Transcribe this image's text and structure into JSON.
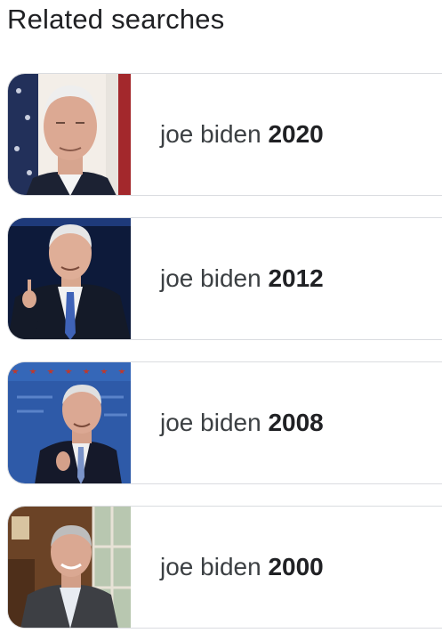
{
  "section": {
    "title": "Related searches"
  },
  "related_searches": [
    {
      "query_prefix": "joe biden",
      "query_bold": "2020",
      "thumbnail": "biden-2020-portrait-photo"
    },
    {
      "query_prefix": "joe biden",
      "query_bold": "2012",
      "thumbnail": "biden-2012-debate-photo"
    },
    {
      "query_prefix": "joe biden",
      "query_bold": "2008",
      "thumbnail": "biden-2008-debate-photo"
    },
    {
      "query_prefix": "joe biden",
      "query_bold": "2000",
      "thumbnail": "biden-2000-office-photo"
    }
  ]
}
